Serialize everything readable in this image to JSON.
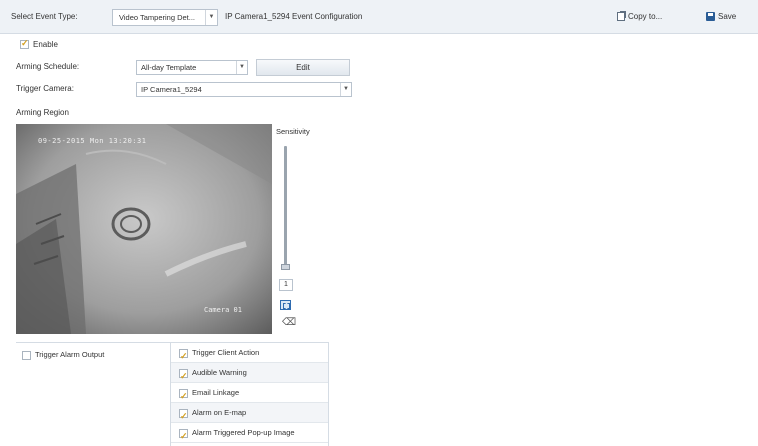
{
  "header": {
    "select_event_type_label": "Select Event Type:",
    "event_type_value": "Video Tampering Det...",
    "config_title": "IP Camera1_5294 Event Configuration",
    "copy_label": "Copy to...",
    "save_label": "Save"
  },
  "enable": {
    "label": "Enable",
    "checked": true
  },
  "arming_schedule": {
    "label": "Arming Schedule:",
    "value": "All-day Template",
    "edit_label": "Edit"
  },
  "trigger_camera": {
    "label": "Trigger Camera:",
    "value": "IP Camera1_5294"
  },
  "arming_region": {
    "label": "Arming Region"
  },
  "video": {
    "osd_time": "09-25-2015 Mon 13:20:31",
    "osd_camera": "Camera 01"
  },
  "sensitivity": {
    "label": "Sensitivity",
    "value": "1",
    "level_fraction": 0.0
  },
  "linkage": {
    "trigger_alarm_output": {
      "label": "Trigger Alarm Output",
      "checked": false
    },
    "actions": [
      {
        "label": "Trigger Client Action",
        "checked": true
      },
      {
        "label": "Audible Warning",
        "checked": true
      },
      {
        "label": "Email Linkage",
        "checked": true
      },
      {
        "label": "Alarm on E-map",
        "checked": true
      },
      {
        "label": "Alarm Triggered Pop-up Image",
        "checked": true
      }
    ]
  },
  "colors": {
    "accent": "#2e6bb0",
    "check": "#d4a021",
    "bar_bg": "#eef2f6"
  }
}
